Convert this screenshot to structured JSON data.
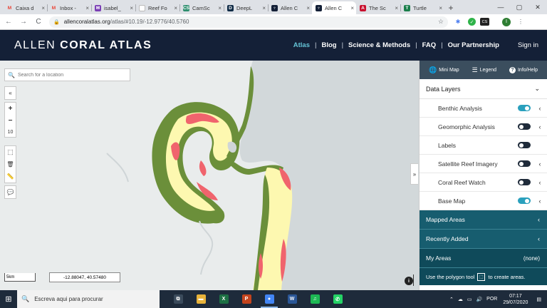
{
  "browser": {
    "tabs": [
      {
        "title": "Caixa d",
        "fav_color": "#ea4335",
        "fav_glyph": "M"
      },
      {
        "title": "Inbox -",
        "fav_color": "#ea4335",
        "fav_glyph": "M"
      },
      {
        "title": "isabel_",
        "fav_color": "#7b3fb5",
        "fav_glyph": "✉"
      },
      {
        "title": "Reef Fo",
        "fav_color": "#ffffff",
        "fav_glyph": ""
      },
      {
        "title": "CamSc",
        "fav_color": "#2f8f6f",
        "fav_glyph": "CS"
      },
      {
        "title": "DeepL",
        "fav_color": "#0f2b46",
        "fav_glyph": "D"
      },
      {
        "title": "Allen C",
        "fav_color": "#142037",
        "fav_glyph": "♆"
      },
      {
        "title": "Allen C",
        "fav_color": "#142037",
        "fav_glyph": "♆",
        "active": true
      },
      {
        "title": "The Sc",
        "fav_color": "#c8102e",
        "fav_glyph": "A"
      },
      {
        "title": "Turtle",
        "fav_color": "#1b7f4b",
        "fav_glyph": "T"
      }
    ],
    "tab_close": "×",
    "newtab": "+",
    "window_min": "—",
    "window_max": "▢",
    "window_close": "✕",
    "url_domain": "allencoralatlas.org",
    "url_path": "/atlas/#10.19/-12.9776/40.5760",
    "nav_back": "←",
    "nav_forward": "→",
    "nav_reload": "C",
    "lock": "🔒",
    "star": "☆",
    "ext_cs": "CS",
    "profile": "I"
  },
  "header": {
    "logo_light": "ALLEN",
    "logo_bold": "CORAL ATLAS",
    "nav": [
      "Atlas",
      "Blog",
      "Science & Methods",
      "FAQ",
      "Our Partnership"
    ],
    "separator": "|",
    "signin": "Sign in"
  },
  "map": {
    "search_placeholder": "Search for a location",
    "search_icon": "🔍",
    "collapse_left": "«",
    "zoom_in": "+",
    "zoom_out": "−",
    "zoom_level": "10",
    "polygon_tool": "⬚",
    "delete_tool": "🗑",
    "ruler_tool": "📏",
    "comment_tool": "💬",
    "scale_label": "5km",
    "coords": "-12.88047, 40.57480",
    "info": "i",
    "expand_panel": "»",
    "colors": {
      "land": "#e9ecec",
      "sea": "#d2d8da",
      "reef_flat": "#fdf8b0",
      "seagrass": "#6b8f3a",
      "coral": "#f0646d"
    }
  },
  "panel": {
    "top_tabs": [
      {
        "label": "Mini Map",
        "icon": "🌐"
      },
      {
        "label": "Legend",
        "icon": "☰"
      },
      {
        "label": "Info/Help",
        "icon": "?"
      }
    ],
    "data_layers_title": "Data Layers",
    "data_layers_chevron": "⌄",
    "layers": [
      {
        "label": "Benthic Analysis",
        "on": true,
        "chevron": "‹"
      },
      {
        "label": "Geomorphic Analysis",
        "on": false,
        "chevron": "‹"
      },
      {
        "label": "Labels",
        "on": false,
        "chevron": ""
      },
      {
        "label": "Satellite Reef Imagery",
        "on": false,
        "chevron": "‹"
      },
      {
        "label": "Coral Reef Watch",
        "on": false,
        "chevron": "‹"
      },
      {
        "label": "Base Map",
        "on": true,
        "chevron": "‹"
      }
    ],
    "mapped_areas": "Mapped Areas",
    "recently_added": "Recently Added",
    "my_areas": "My Areas",
    "my_areas_value": "(none)",
    "section_chevron": "‹",
    "polygon_hint_pre": "Use the polygon tool",
    "polygon_hint_post": "to create areas."
  },
  "taskbar": {
    "start": "⊞",
    "search_placeholder": "Escreva aqui para procurar",
    "search_icon": "🔍",
    "apps": [
      {
        "name": "task-view",
        "color": "#3b4b5c",
        "glyph": "⧉"
      },
      {
        "name": "file-explorer",
        "color": "#e8b33a",
        "glyph": "▬"
      },
      {
        "name": "excel",
        "color": "#1d7044",
        "glyph": "X"
      },
      {
        "name": "powerpoint",
        "color": "#c4441d",
        "glyph": "P"
      },
      {
        "name": "chrome",
        "color": "#4285f4",
        "glyph": "●",
        "active": true
      },
      {
        "name": "word",
        "color": "#2b5797",
        "glyph": "W"
      },
      {
        "name": "spotify",
        "color": "#1db954",
        "glyph": "♫"
      },
      {
        "name": "whatsapp",
        "color": "#25d366",
        "glyph": "✆"
      }
    ],
    "tray_up": "⌃",
    "tray_cloud": "☁",
    "tray_net": "▭",
    "tray_vol": "🔊",
    "lang": "POR",
    "time": "07:17",
    "date": "29/07/2020",
    "notif": "▤"
  }
}
